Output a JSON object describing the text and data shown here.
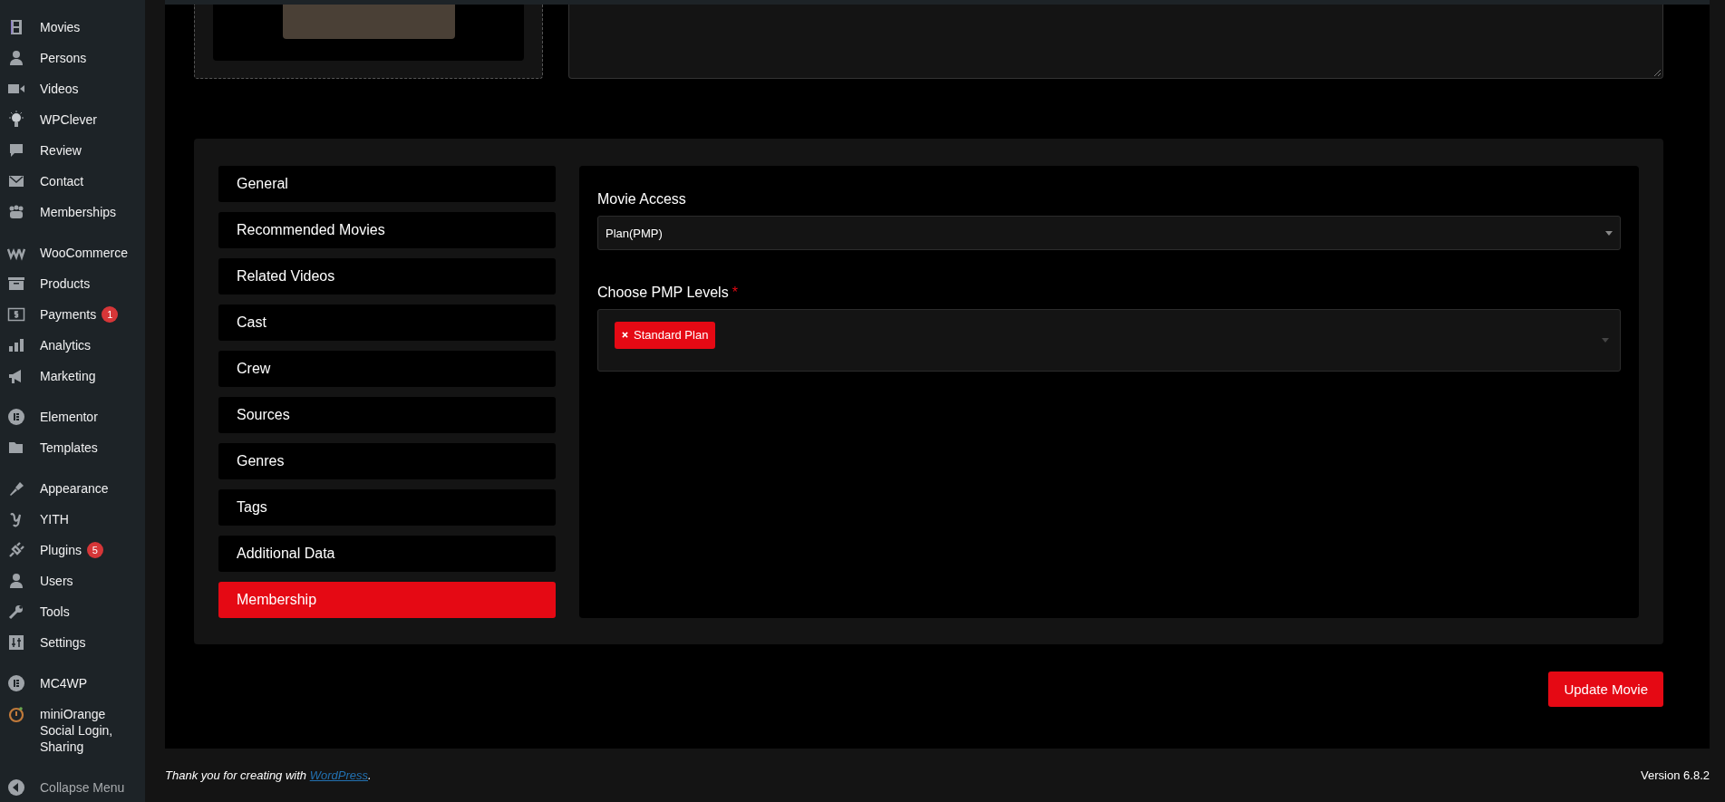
{
  "sidebar": {
    "groups": [
      {
        "items": [
          {
            "label": "Movies"
          },
          {
            "label": "Persons"
          },
          {
            "label": "Videos"
          },
          {
            "label": "WPClever"
          },
          {
            "label": "Review"
          },
          {
            "label": "Contact"
          },
          {
            "label": "Memberships"
          }
        ]
      },
      {
        "items": [
          {
            "label": "WooCommerce"
          },
          {
            "label": "Products"
          },
          {
            "label": "Payments",
            "badge": "1"
          },
          {
            "label": "Analytics"
          },
          {
            "label": "Marketing"
          }
        ]
      },
      {
        "items": [
          {
            "label": "Elementor"
          },
          {
            "label": "Templates"
          }
        ]
      },
      {
        "items": [
          {
            "label": "Appearance"
          },
          {
            "label": "YITH"
          },
          {
            "label": "Plugins",
            "badge": "5"
          },
          {
            "label": "Users"
          },
          {
            "label": "Tools"
          },
          {
            "label": "Settings"
          }
        ]
      },
      {
        "items": [
          {
            "label": "MC4WP"
          },
          {
            "label": "miniOrange Social Login, Sharing"
          }
        ]
      }
    ],
    "collapse": "Collapse Menu"
  },
  "tabs": [
    {
      "label": "General",
      "selected": false
    },
    {
      "label": "Recommended Movies",
      "selected": false
    },
    {
      "label": "Related Videos",
      "selected": false
    },
    {
      "label": "Cast",
      "selected": false
    },
    {
      "label": "Crew",
      "selected": false
    },
    {
      "label": "Sources",
      "selected": false
    },
    {
      "label": "Genres",
      "selected": false
    },
    {
      "label": "Tags",
      "selected": false
    },
    {
      "label": "Additional Data",
      "selected": false
    },
    {
      "label": "Membership",
      "selected": true
    }
  ],
  "membership": {
    "movie_access": {
      "label": "Movie Access",
      "value": "Plan(PMP)"
    },
    "pmp_levels": {
      "label": "Choose PMP Levels",
      "required_mark": "*",
      "tags": [
        {
          "label": "Standard Plan"
        }
      ]
    }
  },
  "update_button": "Update Movie",
  "footer": {
    "text_before": "Thank you for creating with ",
    "link": "WordPress",
    "text_after": ".",
    "version": "Version 6.8.2"
  }
}
